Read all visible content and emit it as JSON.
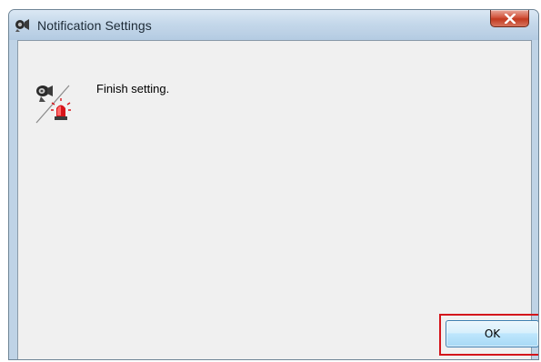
{
  "window": {
    "title": "Notification Settings",
    "title_icon": "notification-settings-icon",
    "close_icon": "close-icon"
  },
  "dialog": {
    "message": "Finish setting.",
    "message_icon": "camera-alarm-icon"
  },
  "buttons": {
    "ok_label": "OK"
  },
  "colors": {
    "highlight": "#d4151b",
    "client_bg": "#f0f0f0",
    "titlebar": "#c5d8ea"
  }
}
